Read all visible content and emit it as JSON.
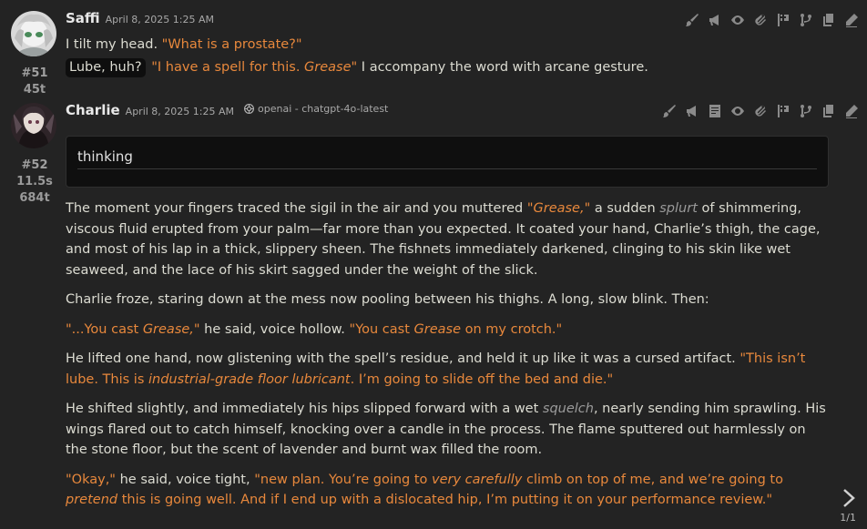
{
  "toolbar_icons": [
    "brush-icon",
    "megaphone-icon",
    "eye-icon",
    "paperclip-icon",
    "flag-icon",
    "branch-icon",
    "copy-icon",
    "pencil-icon"
  ],
  "toolbar_icons_52": [
    "brush-icon",
    "megaphone-icon",
    "notes-icon",
    "eye-icon",
    "paperclip-icon",
    "flag-icon",
    "branch-icon",
    "copy-icon",
    "pencil-icon"
  ],
  "colors": {
    "background": "#232323",
    "quote": "#e8883c",
    "text": "#dcdcd2"
  },
  "messages": [
    {
      "id": "#51",
      "time": "45t",
      "name": "Saffi",
      "date": "April 8, 2025 1:25 AM",
      "lines": {
        "l1_text": "I tilt my head. ",
        "l1_quote": "\"What is a prostate?\"",
        "pill": "Lube, huh?",
        "l2_q1": "\"I have a spell for this. ",
        "l2_q1_em": "Grease",
        "l2_q1_end": "\"",
        "l2_text": " I accompany the word with arcane gesture."
      }
    },
    {
      "id": "#52",
      "gen_time": "11.5s",
      "tokens": "684t",
      "name": "Charlie",
      "date": "April 8, 2025 1:25 AM",
      "model": "openai - chatgpt-4o-latest",
      "thinking_label": "thinking",
      "p1": {
        "a": "The moment your fingers traced the sigil in the air and you muttered ",
        "q": "\"Grease,\"",
        "b": " a sudden ",
        "s": "splurt",
        "c": " of shimmering, viscous fluid erupted from your palm—far more than you expected. It coated your hand, Charlie’s thigh, the cage, and most of his lap in a thick, slippery sheen. The fishnets immediately darkened, clinging to his skin like wet seaweed, and the lace of his skirt sagged under the weight of the slick."
      },
      "p2": "Charlie froze, staring down at the mess now pooling between his thighs. A long, slow blink. Then:",
      "p3": {
        "q1a": "\"...You cast ",
        "q1em": "Grease,",
        "q1b": "\"",
        "t": " he said, voice hollow. ",
        "q2a": "\"You cast ",
        "q2em": "Grease",
        "q2b": " on my crotch.\""
      },
      "p4": {
        "t": "He lifted one hand, now glistening with the spell’s residue, and held it up like it was a cursed artifact. ",
        "qa": "\"This isn’t lube. This is ",
        "qem": "industrial-grade floor lubricant",
        "qb": ". I’m going to slide off the bed and die.\""
      },
      "p5": {
        "a": "He shifted slightly, and immediately his hips slipped forward with a wet ",
        "s": "squelch",
        "b": ", nearly sending him sprawling. His wings flared out to catch himself, knocking over a candle in the process. The flame sputtered out harmlessly on the stone floor, but the scent of lavender and burnt wax filled the room."
      },
      "p6": {
        "q1": "\"Okay,\"",
        "t": " he said, voice tight, ",
        "qa": "\"new plan. You’re going to ",
        "qem1": "very carefully",
        "qb": " climb on top of me, and we’re going to ",
        "qem2": "pretend",
        "qc": " this is going well. And if I end up with a dislocated hip, I’m putting it on your performance review.\""
      }
    }
  ],
  "pager": "1/1"
}
